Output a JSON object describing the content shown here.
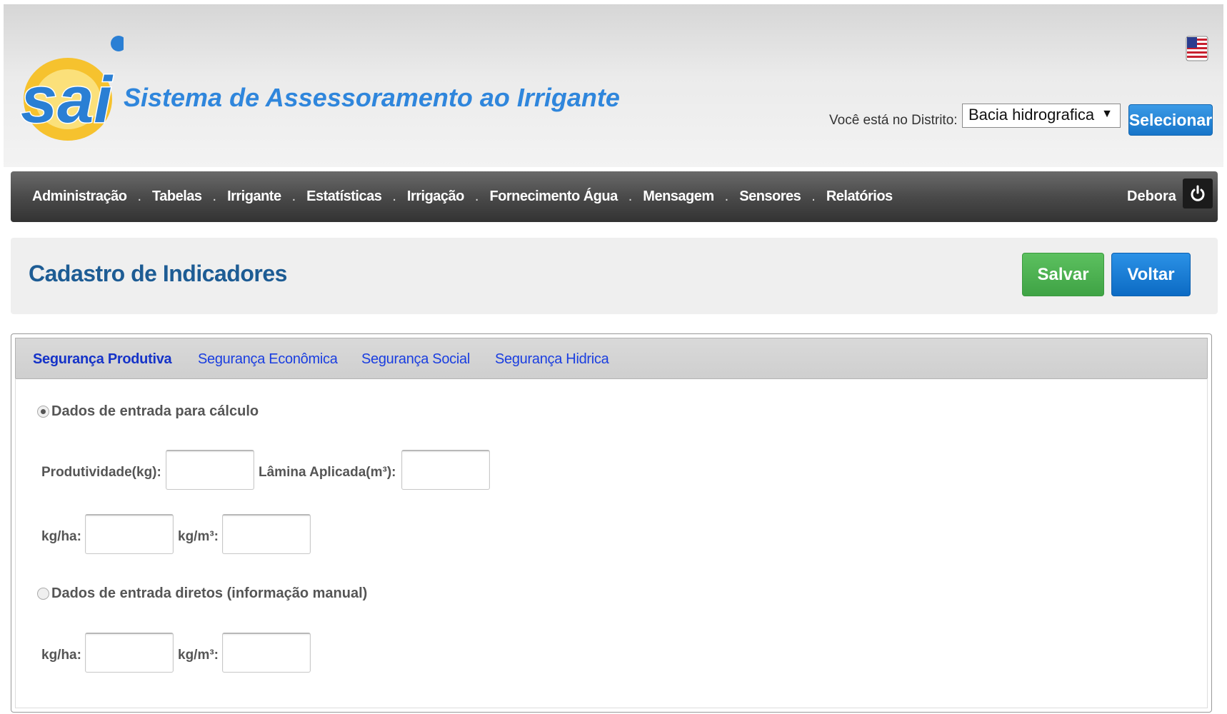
{
  "header": {
    "logo_text": "sai",
    "app_title": "Sistema de Assessoramento ao Irrigante",
    "language_flag": "us-flag-icon",
    "district_label": "Você está no Distrito:",
    "district_selected": "Bacia hidrografica",
    "select_button": "Selecionar"
  },
  "nav": {
    "items": [
      "Administração",
      "Tabelas",
      "Irrigante",
      "Estatísticas",
      "Irrigação",
      "Fornecimento Água",
      "Mensagem",
      "Sensores",
      "Relatórios"
    ],
    "separator": ".",
    "user_name": "Debora",
    "logout_icon": "power-icon"
  },
  "page": {
    "title": "Cadastro de Indicadores",
    "save_button": "Salvar",
    "back_button": "Voltar"
  },
  "tabs": [
    {
      "label": "Segurança Produtiva",
      "active": true
    },
    {
      "label": "Segurança Econômica",
      "active": false
    },
    {
      "label": "Segurança Social",
      "active": false
    },
    {
      "label": "Segurança Hidrica",
      "active": false
    }
  ],
  "form": {
    "calc_option": {
      "label": "Dados de entrada para cálculo",
      "checked": true
    },
    "productivity_label": "Produtividade(kg):",
    "productivity_value": "",
    "water_label": "Lâmina Aplicada(m³):",
    "water_value": "",
    "calc_kgha_label": "kg/ha:",
    "calc_kgha_value": "",
    "calc_kgm3_label": "kg/m³:",
    "calc_kgm3_value": "",
    "direct_option": {
      "label": "Dados de entrada diretos (informação manual)",
      "checked": false
    },
    "direct_kgha_label": "kg/ha:",
    "direct_kgha_value": "",
    "direct_kgm3_label": "kg/m³:",
    "direct_kgm3_value": ""
  },
  "colors": {
    "title_blue": "#2f86dc",
    "page_title": "#1d5c94",
    "save_green": "#4cae4f",
    "back_blue": "#1a7bd6",
    "tab_link": "#1a3ee0",
    "nav_dark": "#4a4a4a"
  }
}
